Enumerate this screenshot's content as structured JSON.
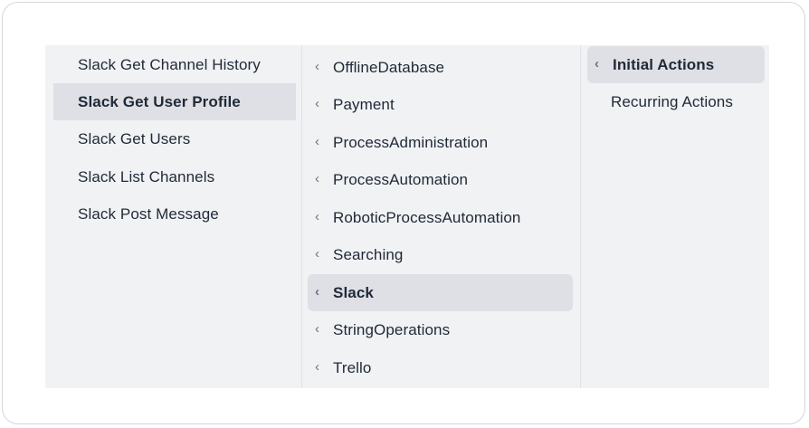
{
  "columns": [
    {
      "items": [
        {
          "label": "Slack Get Channel History",
          "active": false
        },
        {
          "label": "Slack Get User Profile",
          "active": true
        },
        {
          "label": "Slack Get Users",
          "active": false
        },
        {
          "label": "Slack List Channels",
          "active": false
        },
        {
          "label": "Slack Post Message",
          "active": false
        }
      ]
    },
    {
      "items": [
        {
          "label": "OfflineDatabase",
          "active": false
        },
        {
          "label": "Payment",
          "active": false
        },
        {
          "label": "ProcessAdministration",
          "active": false
        },
        {
          "label": "ProcessAutomation",
          "active": false
        },
        {
          "label": "RoboticProcessAutomation",
          "active": false
        },
        {
          "label": "Searching",
          "active": false
        },
        {
          "label": "Slack",
          "active": true
        },
        {
          "label": "StringOperations",
          "active": false
        },
        {
          "label": "Trello",
          "active": false
        }
      ]
    },
    {
      "items": [
        {
          "label": "Initial Actions",
          "active": true
        },
        {
          "label": "Recurring Actions",
          "active": false
        }
      ]
    }
  ],
  "icons": {
    "chevron": "chevron-left-icon",
    "chevron_glyph": "‹"
  },
  "colors": {
    "menu_background": "#f1f2f4",
    "active_background": "#dfe0e5",
    "text": "#1f2937",
    "chevron": "#6b7280"
  }
}
